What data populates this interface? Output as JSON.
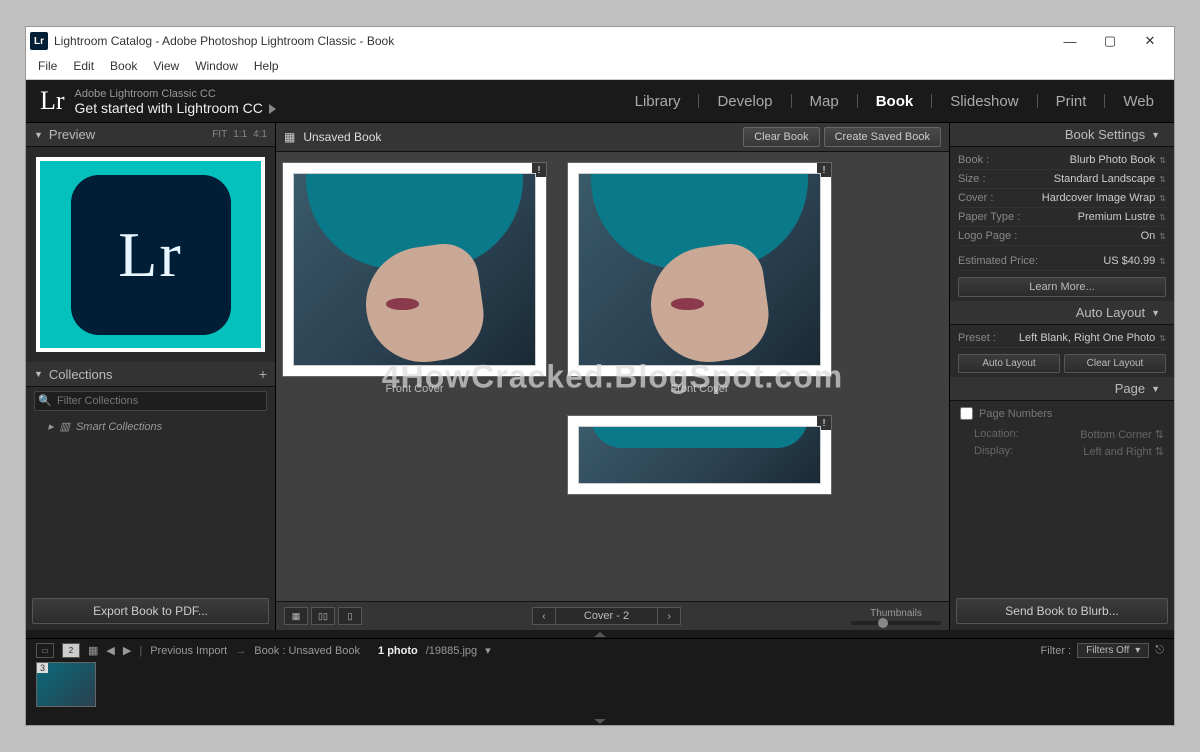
{
  "watermark": "4HowCracked.BlogSpot.com",
  "titlebar": {
    "text": "Lightroom Catalog - Adobe Photoshop Lightroom Classic - Book"
  },
  "menubar": [
    "File",
    "Edit",
    "Book",
    "View",
    "Window",
    "Help"
  ],
  "header": {
    "logo": "Lr",
    "line1": "Adobe Lightroom Classic CC",
    "line2": "Get started with Lightroom CC"
  },
  "modules": [
    "Library",
    "Develop",
    "Map",
    "Book",
    "Slideshow",
    "Print",
    "Web"
  ],
  "activeModule": "Book",
  "leftPanel": {
    "preview": {
      "title": "Preview",
      "opts": [
        "FIT",
        "1:1",
        "4:1"
      ]
    },
    "collections": {
      "title": "Collections",
      "filterPlaceholder": "Filter Collections",
      "smart": "Smart Collections"
    },
    "exportLabel": "Export Book to PDF..."
  },
  "center": {
    "title": "Unsaved Book",
    "clearBtn": "Clear Book",
    "saveBtn": "Create Saved Book",
    "cover1": "Front Cover",
    "cover2": "Front Cover",
    "pagerLabel": "Cover - 2",
    "thumbLabel": "Thumbnails"
  },
  "rightPanel": {
    "bookSettings": {
      "title": "Book Settings",
      "rows": [
        {
          "lbl": "Book :",
          "val": "Blurb Photo Book"
        },
        {
          "lbl": "Size :",
          "val": "Standard Landscape"
        },
        {
          "lbl": "Cover :",
          "val": "Hardcover Image Wrap"
        },
        {
          "lbl": "Paper Type :",
          "val": "Premium Lustre"
        },
        {
          "lbl": "Logo Page :",
          "val": "On"
        }
      ],
      "price": {
        "lbl": "Estimated Price:",
        "val": "US $40.99"
      },
      "learn": "Learn More..."
    },
    "autoLayout": {
      "title": "Auto Layout",
      "preset": {
        "lbl": "Preset :",
        "val": "Left Blank, Right One Photo"
      },
      "btn1": "Auto Layout",
      "btn2": "Clear Layout"
    },
    "page": {
      "title": "Page",
      "pageNumbers": "Page Numbers",
      "loc": {
        "lbl": "Location:",
        "val": "Bottom Corner"
      },
      "disp": {
        "lbl": "Display:",
        "val": "Left and Right"
      }
    },
    "sendLabel": "Send Book to Blurb..."
  },
  "filmstrip": {
    "prevImport": "Previous Import",
    "bookLabel": "Book : Unsaved Book",
    "count": "1 photo",
    "file": "/19885.jpg",
    "filterLabel": "Filter :",
    "filterValue": "Filters Off",
    "thumbBadge": "3",
    "number2": "2"
  }
}
